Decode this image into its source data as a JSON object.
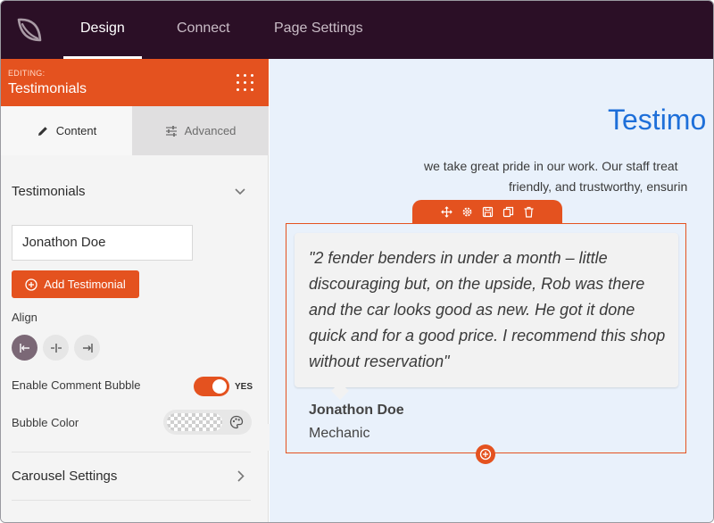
{
  "topbar": {
    "tabs": [
      {
        "label": "Design",
        "active": true
      },
      {
        "label": "Connect",
        "active": false
      },
      {
        "label": "Page Settings",
        "active": false
      }
    ]
  },
  "sidebar": {
    "editing_label": "EDITING:",
    "editing_title": "Testimonials",
    "tabs": {
      "content": "Content",
      "advanced": "Advanced"
    },
    "section_title": "Testimonials",
    "testimonial_item": "Jonathon Doe",
    "add_button": "Add Testimonial",
    "align_label": "Align",
    "align_options": [
      "left",
      "center",
      "right"
    ],
    "align_selected": "left",
    "comment_bubble_label": "Enable Comment Bubble",
    "comment_bubble_value": "YES",
    "bubble_color_label": "Bubble Color",
    "carousel_settings": "Carousel Settings"
  },
  "preview": {
    "title": "Testimo",
    "subtitle_line1": "we take great pride in our work. Our staff treat",
    "subtitle_line2": "friendly, and trustworthy, ensurin",
    "quote": "\"2 fender benders in under a month – little discouraging but, on the upside, Rob was there and the car looks good as new. He got it done quick and for a good price. I recommend this shop without reservation\"",
    "author": "Jonathon Doe",
    "role": "Mechanic"
  },
  "colors": {
    "accent": "#e4521f",
    "topbar": "#2b0f26",
    "title_blue": "#1e6fd9",
    "preview_bg": "#e9f1fb"
  }
}
